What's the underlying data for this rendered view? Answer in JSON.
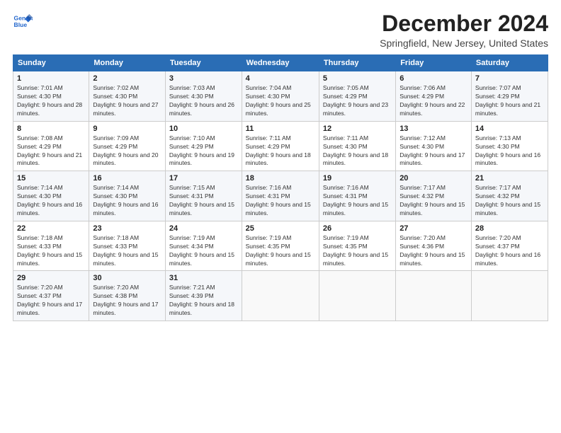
{
  "header": {
    "logo_line1": "General",
    "logo_line2": "Blue",
    "title": "December 2024",
    "subtitle": "Springfield, New Jersey, United States"
  },
  "days_of_week": [
    "Sunday",
    "Monday",
    "Tuesday",
    "Wednesday",
    "Thursday",
    "Friday",
    "Saturday"
  ],
  "weeks": [
    [
      {
        "day": "1",
        "sunrise": "7:01 AM",
        "sunset": "4:30 PM",
        "daylight": "9 hours and 28 minutes."
      },
      {
        "day": "2",
        "sunrise": "7:02 AM",
        "sunset": "4:30 PM",
        "daylight": "9 hours and 27 minutes."
      },
      {
        "day": "3",
        "sunrise": "7:03 AM",
        "sunset": "4:30 PM",
        "daylight": "9 hours and 26 minutes."
      },
      {
        "day": "4",
        "sunrise": "7:04 AM",
        "sunset": "4:30 PM",
        "daylight": "9 hours and 25 minutes."
      },
      {
        "day": "5",
        "sunrise": "7:05 AM",
        "sunset": "4:29 PM",
        "daylight": "9 hours and 23 minutes."
      },
      {
        "day": "6",
        "sunrise": "7:06 AM",
        "sunset": "4:29 PM",
        "daylight": "9 hours and 22 minutes."
      },
      {
        "day": "7",
        "sunrise": "7:07 AM",
        "sunset": "4:29 PM",
        "daylight": "9 hours and 21 minutes."
      }
    ],
    [
      {
        "day": "8",
        "sunrise": "7:08 AM",
        "sunset": "4:29 PM",
        "daylight": "9 hours and 21 minutes."
      },
      {
        "day": "9",
        "sunrise": "7:09 AM",
        "sunset": "4:29 PM",
        "daylight": "9 hours and 20 minutes."
      },
      {
        "day": "10",
        "sunrise": "7:10 AM",
        "sunset": "4:29 PM",
        "daylight": "9 hours and 19 minutes."
      },
      {
        "day": "11",
        "sunrise": "7:11 AM",
        "sunset": "4:29 PM",
        "daylight": "9 hours and 18 minutes."
      },
      {
        "day": "12",
        "sunrise": "7:11 AM",
        "sunset": "4:30 PM",
        "daylight": "9 hours and 18 minutes."
      },
      {
        "day": "13",
        "sunrise": "7:12 AM",
        "sunset": "4:30 PM",
        "daylight": "9 hours and 17 minutes."
      },
      {
        "day": "14",
        "sunrise": "7:13 AM",
        "sunset": "4:30 PM",
        "daylight": "9 hours and 16 minutes."
      }
    ],
    [
      {
        "day": "15",
        "sunrise": "7:14 AM",
        "sunset": "4:30 PM",
        "daylight": "9 hours and 16 minutes."
      },
      {
        "day": "16",
        "sunrise": "7:14 AM",
        "sunset": "4:30 PM",
        "daylight": "9 hours and 16 minutes."
      },
      {
        "day": "17",
        "sunrise": "7:15 AM",
        "sunset": "4:31 PM",
        "daylight": "9 hours and 15 minutes."
      },
      {
        "day": "18",
        "sunrise": "7:16 AM",
        "sunset": "4:31 PM",
        "daylight": "9 hours and 15 minutes."
      },
      {
        "day": "19",
        "sunrise": "7:16 AM",
        "sunset": "4:31 PM",
        "daylight": "9 hours and 15 minutes."
      },
      {
        "day": "20",
        "sunrise": "7:17 AM",
        "sunset": "4:32 PM",
        "daylight": "9 hours and 15 minutes."
      },
      {
        "day": "21",
        "sunrise": "7:17 AM",
        "sunset": "4:32 PM",
        "daylight": "9 hours and 15 minutes."
      }
    ],
    [
      {
        "day": "22",
        "sunrise": "7:18 AM",
        "sunset": "4:33 PM",
        "daylight": "9 hours and 15 minutes."
      },
      {
        "day": "23",
        "sunrise": "7:18 AM",
        "sunset": "4:33 PM",
        "daylight": "9 hours and 15 minutes."
      },
      {
        "day": "24",
        "sunrise": "7:19 AM",
        "sunset": "4:34 PM",
        "daylight": "9 hours and 15 minutes."
      },
      {
        "day": "25",
        "sunrise": "7:19 AM",
        "sunset": "4:35 PM",
        "daylight": "9 hours and 15 minutes."
      },
      {
        "day": "26",
        "sunrise": "7:19 AM",
        "sunset": "4:35 PM",
        "daylight": "9 hours and 15 minutes."
      },
      {
        "day": "27",
        "sunrise": "7:20 AM",
        "sunset": "4:36 PM",
        "daylight": "9 hours and 15 minutes."
      },
      {
        "day": "28",
        "sunrise": "7:20 AM",
        "sunset": "4:37 PM",
        "daylight": "9 hours and 16 minutes."
      }
    ],
    [
      {
        "day": "29",
        "sunrise": "7:20 AM",
        "sunset": "4:37 PM",
        "daylight": "9 hours and 17 minutes."
      },
      {
        "day": "30",
        "sunrise": "7:20 AM",
        "sunset": "4:38 PM",
        "daylight": "9 hours and 17 minutes."
      },
      {
        "day": "31",
        "sunrise": "7:21 AM",
        "sunset": "4:39 PM",
        "daylight": "9 hours and 18 minutes."
      },
      null,
      null,
      null,
      null
    ]
  ],
  "labels": {
    "sunrise": "Sunrise:",
    "sunset": "Sunset:",
    "daylight": "Daylight:"
  }
}
